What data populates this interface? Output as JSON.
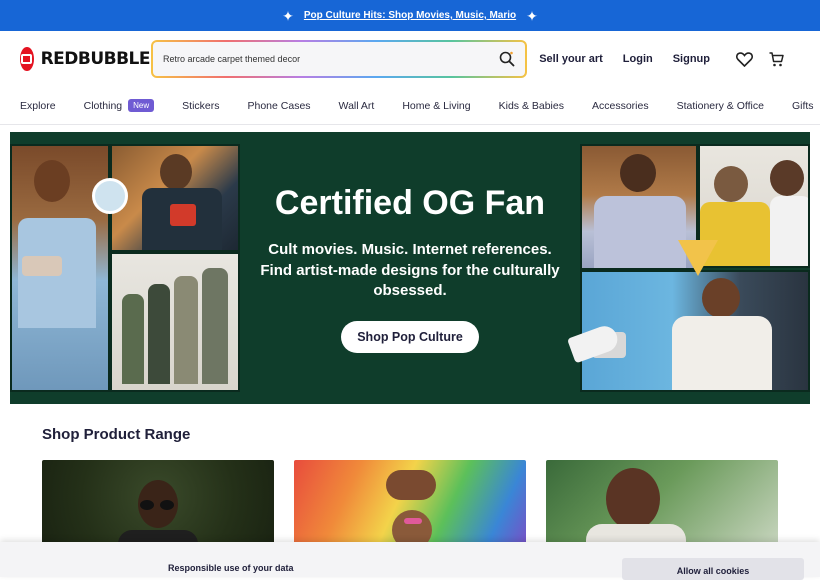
{
  "promo": {
    "text": "Pop Culture Hits: Shop Movies, Music, Mario"
  },
  "header": {
    "brand": "REDBUBBLE",
    "search_value": "Retro arcade carpet themed decor",
    "links": {
      "sell": "Sell your art",
      "login": "Login",
      "signup": "Signup"
    }
  },
  "nav": {
    "items": [
      "Explore",
      "Clothing",
      "Stickers",
      "Phone Cases",
      "Wall Art",
      "Home & Living",
      "Kids & Babies",
      "Accessories",
      "Stationery & Office",
      "Gifts"
    ],
    "clothing_badge": "New"
  },
  "hero": {
    "title": "Certified OG Fan",
    "subtitle_line1": "Cult movies. Music. Internet references.",
    "subtitle_line2": "Find artist-made designs for the culturally",
    "subtitle_line3": "obsessed.",
    "cta": "Shop Pop Culture",
    "bg_color": "#0f3d2b"
  },
  "product_range": {
    "title": "Shop Product Range"
  },
  "cookie": {
    "title": "Responsible use of your data",
    "allow_button": "Allow all cookies"
  },
  "colors": {
    "promo_bar": "#1766d6",
    "brand_red": "#e41321",
    "badge": "#6f5bd3"
  },
  "icons": [
    "sparkle-icon",
    "redbubble-logo-icon",
    "search-icon",
    "heart-icon",
    "cart-icon"
  ]
}
